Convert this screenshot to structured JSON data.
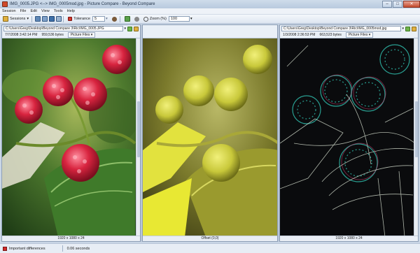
{
  "window": {
    "title": "IMG_0005.JPG <--> IMG_0005mod.jpg - Picture Compare - Beyond Compare",
    "minimize_glyph": "–",
    "maximize_glyph": "□",
    "close_glyph": "✕"
  },
  "menu": [
    "Session",
    "File",
    "Edit",
    "View",
    "Tools",
    "Help"
  ],
  "toolbar": {
    "sessions_label": "Sessions",
    "tolerance_label": "Tolerance",
    "tolerance_value": "5",
    "zoom_label": "Zoom (%)",
    "zoom_value": "100",
    "dropdown_glyph": "▾"
  },
  "left_pane": {
    "path": "C:\\Users\\Greg\\Desktop\\Beyond Compare 3\\Ric\\IMG_0005.JPG",
    "date": "7/7/2008 3:42:14 PM",
    "size": "959,536 bytes",
    "file_type": "Picture Files",
    "footer": "1920 x 1080 x 24"
  },
  "center_pane": {
    "footer": "Offset (0,0)"
  },
  "right_pane": {
    "path": "C:\\Users\\Greg\\Desktop\\Beyond Compare 3\\Ric\\IMG_0005mod.jpg",
    "date": "1/3/2008 2:36:53 PM",
    "size": "663,523 bytes",
    "file_type": "Picture Files",
    "footer": "1920 x 1080 x 24"
  },
  "status": {
    "differences_label": "Important differences",
    "elapsed": "0.06 seconds"
  },
  "colors": {
    "title_bar": "#c4d3e6",
    "highlight_red": "#d12a2a",
    "diff_tint": "#c8c83a"
  }
}
